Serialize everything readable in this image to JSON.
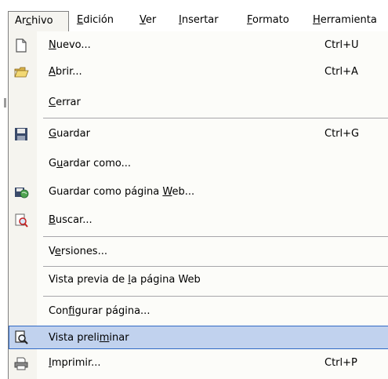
{
  "menubar": {
    "items": [
      {
        "pre": "Ar",
        "u": "c",
        "post": "hivo"
      },
      {
        "pre": "",
        "u": "E",
        "post": "dición"
      },
      {
        "pre": "",
        "u": "V",
        "post": "er"
      },
      {
        "pre": "",
        "u": "I",
        "post": "nsertar"
      },
      {
        "pre": "",
        "u": "F",
        "post": "ormato"
      },
      {
        "pre": "",
        "u": "H",
        "post": "erramienta"
      }
    ]
  },
  "menu": {
    "items": [
      {
        "pre": "",
        "u": "N",
        "post": "uevo...",
        "shortcut": "Ctrl+U",
        "icon": "new-document-icon"
      },
      {
        "pre": "",
        "u": "A",
        "post": "brir...",
        "shortcut": "Ctrl+A",
        "icon": "open-folder-icon"
      },
      {
        "pre": "",
        "u": "C",
        "post": "errar",
        "shortcut": "",
        "icon": ""
      },
      {
        "pre": "",
        "u": "G",
        "post": "uardar",
        "shortcut": "Ctrl+G",
        "icon": "save-disk-icon"
      },
      {
        "pre": "G",
        "u": "u",
        "post": "ardar como...",
        "shortcut": "",
        "icon": ""
      },
      {
        "pre": "Guardar como página ",
        "u": "W",
        "post": "eb...",
        "shortcut": "",
        "icon": "save-as-web-icon"
      },
      {
        "pre": "",
        "u": "B",
        "post": "uscar...",
        "shortcut": "",
        "icon": "search-file-icon"
      },
      {
        "pre": "V",
        "u": "e",
        "post": "rsiones...",
        "shortcut": "",
        "icon": ""
      },
      {
        "pre": "Vista previa de ",
        "u": "l",
        "post": "a página Web",
        "shortcut": "",
        "icon": ""
      },
      {
        "pre": "Con",
        "u": "f",
        "post": "igurar página...",
        "shortcut": "",
        "icon": ""
      },
      {
        "pre": "Vista preli",
        "u": "m",
        "post": "inar",
        "shortcut": "",
        "icon": "print-preview-icon"
      },
      {
        "pre": "",
        "u": "I",
        "post": "mprimir...",
        "shortcut": "Ctrl+P",
        "icon": "printer-icon"
      }
    ]
  }
}
